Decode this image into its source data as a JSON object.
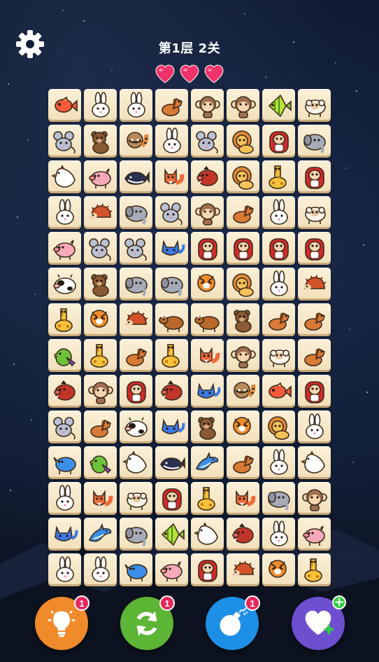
{
  "header": {
    "level_text": "第1层 2关",
    "lives": 3
  },
  "board": {
    "rows": [
      [
        "fish",
        "rabbit",
        "rabbit",
        "horse",
        "monkey",
        "monkey",
        "angelfish",
        "sheep"
      ],
      [
        "mouse",
        "bear",
        "raccoon",
        "rabbit",
        "mouse",
        "lion",
        "gorilla",
        "elephant"
      ],
      [
        "chicken",
        "pig",
        "whale",
        "fox",
        "boar",
        "lion",
        "giraffe",
        "gorilla"
      ],
      [
        "rabbit",
        "hedgehog",
        "elephant",
        "mouse",
        "monkey",
        "horse",
        "rabbit",
        "sheep"
      ],
      [
        "pig",
        "mouse",
        "mouse",
        "cat",
        "gorilla",
        "gorilla",
        "gorilla",
        "gorilla"
      ],
      [
        "cow",
        "bear",
        "elephant",
        "elephant",
        "tiger",
        "lion",
        "rabbit",
        "hedgehog"
      ],
      [
        "giraffe",
        "tiger",
        "hedgehog",
        "bull",
        "bull",
        "bear",
        "horse",
        "horse"
      ],
      [
        "parrot",
        "giraffe",
        "horse",
        "giraffe",
        "fox",
        "monkey",
        "sheep",
        "horse"
      ],
      [
        "boar",
        "monkey",
        "gorilla",
        "boar",
        "cat",
        "raccoon",
        "fish",
        "gorilla"
      ],
      [
        "mouse",
        "horse",
        "cow",
        "cat",
        "bear",
        "tiger",
        "lion",
        "rabbit"
      ],
      [
        "rhino",
        "parrot",
        "chicken",
        "whale",
        "dolphin",
        "horse",
        "rabbit",
        "chicken"
      ],
      [
        "rabbit",
        "fox",
        "sheep",
        "gorilla",
        "giraffe",
        "fox",
        "elephant",
        "monkey"
      ],
      [
        "cat",
        "dolphin",
        "elephant",
        "angelfish",
        "chicken",
        "boar",
        "rabbit",
        "pig"
      ],
      [
        "rabbit",
        "rabbit",
        "rhino",
        "pig",
        "gorilla",
        "hedgehog",
        "tiger",
        "giraffe"
      ]
    ]
  },
  "tools": [
    {
      "name": "hint",
      "icon": "lightbulb-icon",
      "badge": "1",
      "color": "#f08a2b"
    },
    {
      "name": "shuffle",
      "icon": "refresh-icon",
      "badge": "1",
      "color": "#5db535"
    },
    {
      "name": "bomb",
      "icon": "bomb-icon",
      "badge": "1",
      "color": "#1d8fe6"
    },
    {
      "name": "add-life",
      "icon": "heart-plus-icon",
      "badge": "+",
      "color": "#6e4fd0"
    }
  ]
}
